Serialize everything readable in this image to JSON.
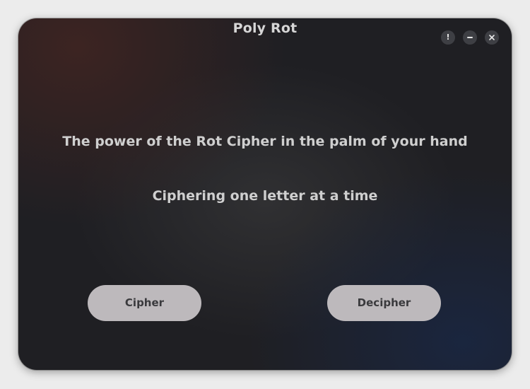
{
  "window": {
    "title": "Poly Rot",
    "controls": {
      "about_glyph": "!",
      "minimize_icon": "minimize-icon",
      "close_icon": "close-icon"
    }
  },
  "main": {
    "headline": "The power of the Rot Cipher in the palm of your hand",
    "subline": "Ciphering one letter at a time",
    "cipher_button": "Cipher",
    "decipher_button": "Decipher"
  },
  "colors": {
    "button_bg": "#bdb9bc",
    "button_text": "#3a3a3d",
    "text": "#cfcfcf",
    "window_bg": "#1f1f23"
  }
}
